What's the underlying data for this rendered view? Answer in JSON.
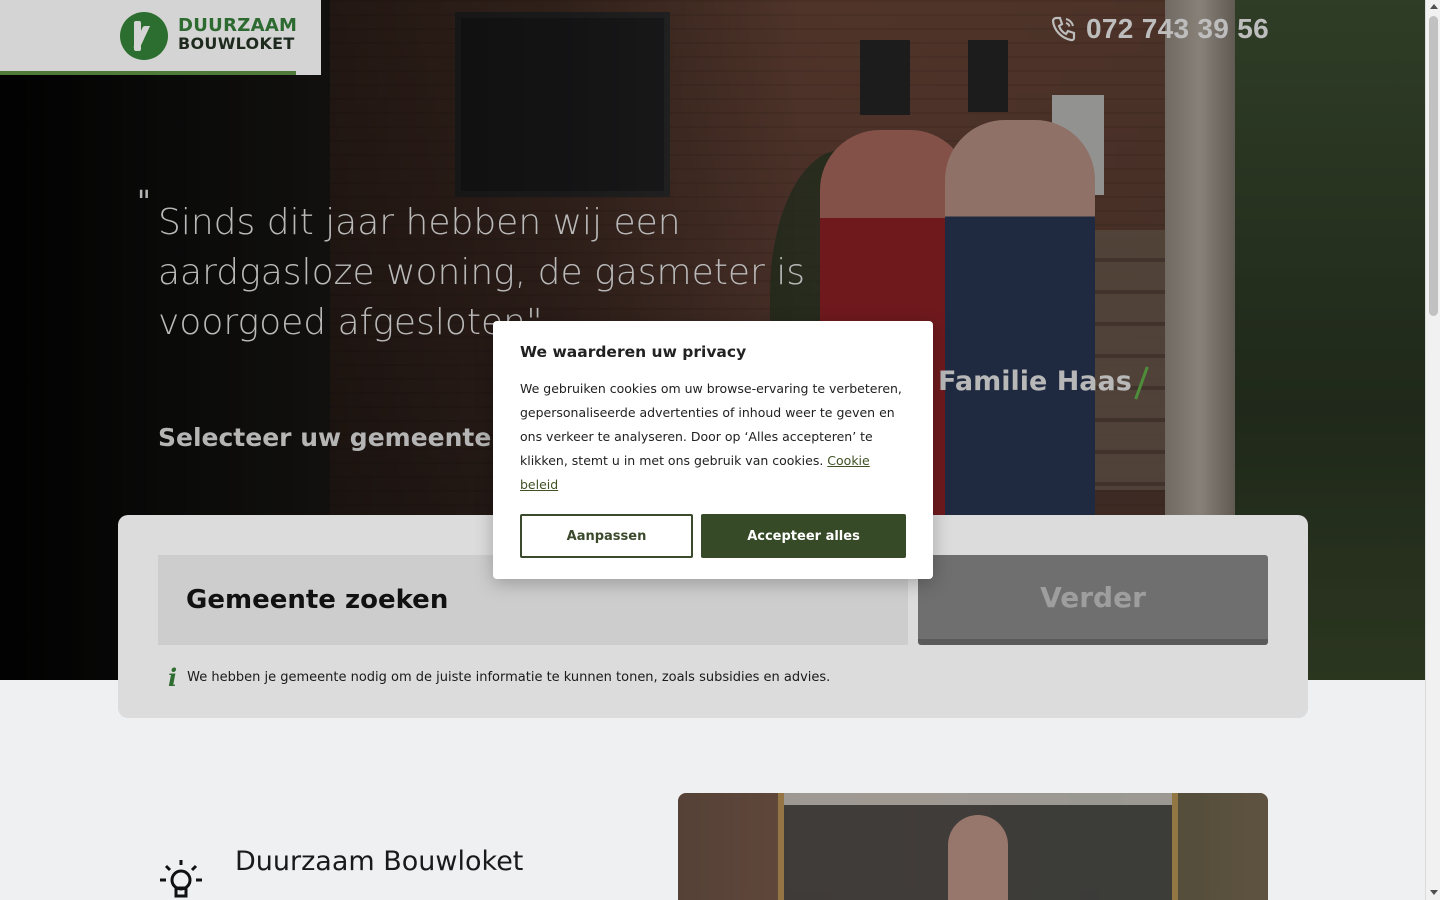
{
  "header": {
    "logo_line1": "DUURZAAM",
    "logo_line2": "BOUWLOKET",
    "phone": "072 743 39 56"
  },
  "hero": {
    "quote_mark": "\"",
    "quote": "Sinds dit jaar hebben wij een aardgasloze woning, de gasmeter is voorgoed afgesloten\"",
    "author": "Familie Haas",
    "select_title": "Selecteer uw gemeente"
  },
  "search": {
    "placeholder": "Gemeente zoeken",
    "button": "Verder",
    "info": "We hebben je gemeente nodig om de juiste informatie te kunnen tonen, zoals subsidies en advies."
  },
  "section": {
    "title": "Duurzaam Bouwloket"
  },
  "cookie_modal": {
    "title": "We waarderen uw privacy",
    "body": "We gebruiken cookies om uw browse-ervaring te verbeteren, gepersonaliseerde advertenties of inhoud weer te geven en ons verkeer te analyseren. Door op ‘Alles accepteren’ te klikken, stemt u in met ons gebruik van cookies.",
    "policy_link": "Cookie beleid",
    "customize_button": "Aanpassen",
    "accept_button": "Accepteer alles"
  },
  "colors": {
    "brand_green": "#2d6a2f",
    "accept_button": "#374a27",
    "accent_bar": "#4f7a3a"
  },
  "icons": {
    "phone": "phone-icon",
    "info": "info-icon",
    "bulb": "lightbulb-icon"
  }
}
